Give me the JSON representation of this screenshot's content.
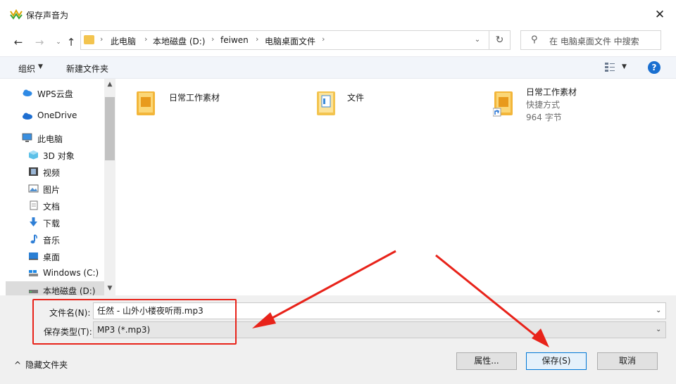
{
  "window": {
    "title": "保存声音为",
    "close_glyph": "✕"
  },
  "nav": {
    "back_glyph": "←",
    "forward_glyph": "→",
    "recent_glyph": "⌄",
    "up_glyph": "↑",
    "breadcrumbs": [
      "此电脑",
      "本地磁盘 (D:)",
      "feiwen",
      "电脑桌面文件"
    ],
    "crumb_separator": "›",
    "dropdown_glyph": "⌄",
    "refresh_glyph": "↻",
    "search_placeholder": "在 电脑桌面文件 中搜索",
    "search_glyph": "⚲"
  },
  "toolbar": {
    "organize": "组织",
    "organize_arrow": "▼",
    "new_folder": "新建文件夹",
    "view_arrow": "▼",
    "help": "?"
  },
  "sidebar": {
    "items": [
      {
        "label": "WPS云盘",
        "icon": "wps-cloud-icon"
      },
      {
        "label": "OneDrive",
        "icon": "onedrive-cloud-icon"
      },
      {
        "label": "此电脑",
        "icon": "computer-icon"
      },
      {
        "label": "3D 对象",
        "icon": "3d-objects-icon"
      },
      {
        "label": "视频",
        "icon": "video-icon"
      },
      {
        "label": "图片",
        "icon": "pictures-icon"
      },
      {
        "label": "文档",
        "icon": "documents-icon"
      },
      {
        "label": "下载",
        "icon": "download-icon"
      },
      {
        "label": "音乐",
        "icon": "music-icon"
      },
      {
        "label": "桌面",
        "icon": "desktop-icon"
      },
      {
        "label": "Windows (C:)",
        "icon": "drive-c-icon"
      },
      {
        "label": "本地磁盘 (D:)",
        "icon": "drive-d-icon",
        "selected": true
      }
    ],
    "scroll_up": "▲",
    "scroll_down": "▼"
  },
  "files": [
    {
      "name": "日常工作素材",
      "icon": "folder-icon"
    },
    {
      "name": "文件",
      "icon": "folder-doc-icon"
    },
    {
      "name": "日常工作素材",
      "sub1": "快捷方式",
      "sub2": "964 字节",
      "icon": "folder-shortcut-icon"
    }
  ],
  "bottom": {
    "filename_label": "文件名(N):",
    "filename_value": "任然 - 山外小楼夜听雨.mp3",
    "filetype_label": "保存类型(T):",
    "filetype_value": "MP3 (*.mp3)",
    "dropdown_glyph": "⌄",
    "hide_folders": "隐藏文件夹",
    "hide_folders_glyph": "^",
    "btn_properties": "属性...",
    "btn_save": "保存(S)",
    "btn_cancel": "取消"
  },
  "colors": {
    "accent_blue": "#0078d7",
    "annotation_red": "#e8231a",
    "folder_yellow": "#f3c44f"
  }
}
